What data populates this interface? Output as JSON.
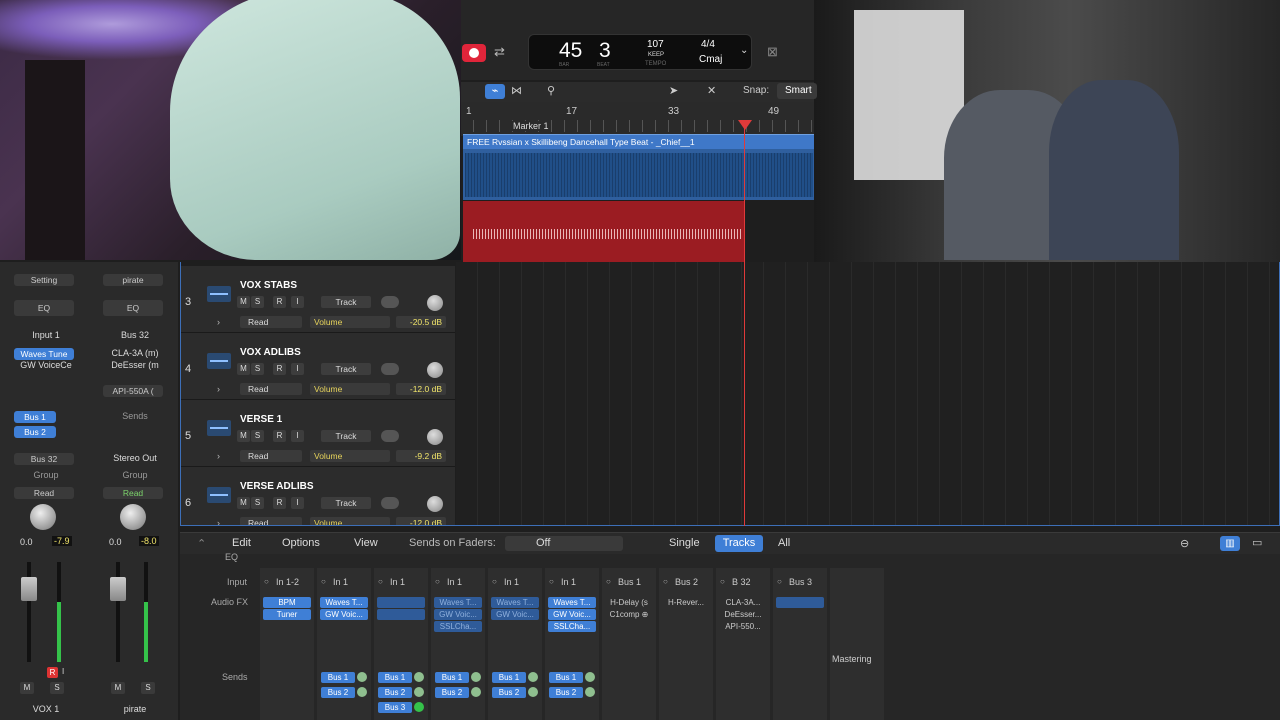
{
  "transport": {
    "bar": "45",
    "beat": "3",
    "bar_label": "BAR",
    "beat_label": "BEAT",
    "tempo": "107",
    "keep": "KEEP",
    "tempo_label": "TEMPO",
    "signature": "4/4",
    "key": "Cmaj"
  },
  "toolbar": {
    "snap_label": "Snap:",
    "snap_value": "Smart"
  },
  "ruler": {
    "marks": [
      "1",
      "17",
      "33",
      "49"
    ],
    "marker": "Marker 1"
  },
  "regions": {
    "beat_region": "FREE Rvssian x Skillibeng Dancehall Type Beat - _Chief__1"
  },
  "inspector": {
    "left": {
      "setting": "Setting",
      "eq": "EQ",
      "input": "Input 1",
      "fx1": "Waves Tune",
      "fx2": "GW VoiceCe",
      "send1": "Bus 1",
      "send2": "Bus 2",
      "output": "Bus 32",
      "group": "Group",
      "automation": "Read",
      "vol": "0.0",
      "peak": "-7.9",
      "rec": "R",
      "input_mon": "I",
      "mute": "M",
      "solo": "S",
      "name": "VOX 1"
    },
    "right": {
      "setting": "pirate",
      "eq": "EQ",
      "input": "Bus 32",
      "fx1": "CLA-3A (m)",
      "fx2": "DeEsser (m",
      "fx3": "API-550A (",
      "sends": "Sends",
      "output": "Stereo Out",
      "group": "Group",
      "automation": "Read",
      "vol": "0.0",
      "peak": "-8.0",
      "mute": "M",
      "solo": "S",
      "name": "pirate"
    }
  },
  "tracks": [
    {
      "num": "3",
      "name": "VOX STABS",
      "mode": "Read",
      "param": "Volume",
      "db": "-20.5 dB"
    },
    {
      "num": "4",
      "name": "VOX ADLIBS",
      "mode": "Read",
      "param": "Volume",
      "db": "-12.0 dB"
    },
    {
      "num": "5",
      "name": "VERSE 1",
      "mode": "Read",
      "param": "Volume",
      "db": "-9.2 dB"
    },
    {
      "num": "6",
      "name": "VERSE ADLIBS",
      "mode": "Read",
      "param": "Volume",
      "db": "-12.0 dB"
    }
  ],
  "track_buttons": {
    "m": "M",
    "s": "S",
    "r": "R",
    "i": "I",
    "track": "Track"
  },
  "mixbar": {
    "edit": "Edit",
    "options": "Options",
    "view": "View",
    "sends_on_faders": "Sends on Faders:",
    "sends_value": "Off",
    "single": "Single",
    "tracks": "Tracks",
    "all": "All"
  },
  "mixer": {
    "labels": {
      "eq": "EQ",
      "input": "Input",
      "audio_fx": "Audio FX",
      "sends": "Sends"
    },
    "strips": [
      {
        "input": "In 1-2",
        "fx": [
          "BPM",
          "Tuner"
        ],
        "sends": []
      },
      {
        "input": "In 1",
        "fx": [
          "Waves T...",
          "GW Voic..."
        ],
        "sends": [
          "Bus 1",
          "Bus 2"
        ]
      },
      {
        "input": "In 1",
        "fx": [
          "",
          ""
        ],
        "sends": [
          "Bus 1",
          "Bus 2",
          "Bus 3"
        ]
      },
      {
        "input": "In 1",
        "fx": [
          "Waves T...",
          "GW Voic...",
          "SSLCha..."
        ],
        "sends": [
          "Bus 1",
          "Bus 2"
        ]
      },
      {
        "input": "In 1",
        "fx": [
          "Waves T...",
          "GW Voic..."
        ],
        "sends": [
          "Bus 1",
          "Bus 2"
        ]
      },
      {
        "input": "In 1",
        "fx": [
          "Waves T...",
          "GW Voic...",
          "SSLCha..."
        ],
        "sends": [
          "Bus 1",
          "Bus 2"
        ]
      },
      {
        "input": "Bus 1",
        "fx": [
          "H-Delay (s",
          "C1comp ⊕"
        ],
        "sends": []
      },
      {
        "input": "Bus 2",
        "fx": [
          "H-Rever..."
        ],
        "sends": []
      },
      {
        "input": "B 32",
        "fx": [
          "CLA-3A...",
          "DeEsser...",
          "API-550..."
        ],
        "sends": []
      },
      {
        "input": "Bus 3",
        "fx": [
          ""
        ],
        "sends": []
      },
      {
        "input": "",
        "fx": [],
        "sends": [],
        "name": "Mastering"
      }
    ]
  },
  "colors": {
    "accent": "#3f7fd6",
    "record": "#e0253a",
    "playhead": "#e03a3a",
    "region_blue": "#2f5f9e",
    "region_red": "#9b1c22",
    "meter_green": "#35c24a"
  }
}
